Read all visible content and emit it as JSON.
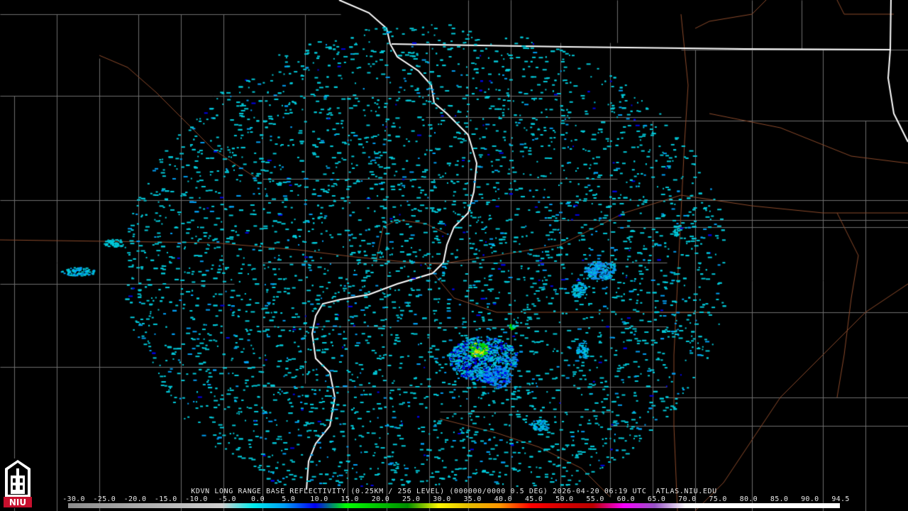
{
  "product": {
    "caption": "KDVN LONG RANGE BASE REFLECTIVITY (0.25KM / 256 LEVEL) (000000/0000 0.5 DEG) 2026-04-20 06:19 UTC  ATLAS.NIU.EDU"
  },
  "color_scale": {
    "labels": [
      "-30.0",
      "-25.0",
      "-20.0",
      "-15.0",
      "-10.0",
      "-5.0",
      "0.0",
      "5.0",
      "10.0",
      "15.0",
      "20.0",
      "25.0",
      "30.0",
      "35.0",
      "40.0",
      "45.0",
      "50.0",
      "55.0",
      "60.0",
      "65.0",
      "70.0",
      "75.0",
      "80.0",
      "85.0",
      "90.0",
      "94.5"
    ],
    "values": [
      -30,
      -25,
      -20,
      -15,
      -10,
      -5,
      0,
      5,
      10,
      15,
      20,
      25,
      30,
      35,
      40,
      45,
      50,
      55,
      60,
      65,
      70,
      75,
      80,
      85,
      90,
      94.5
    ],
    "colors": [
      "#8c8c8c",
      "#9a9a9a",
      "#a8a8a8",
      "#b5b5b5",
      "#c3c3c3",
      "#d0d0d0",
      "#02ecec",
      "#019ff4",
      "#0300f4",
      "#02fd02",
      "#01c501",
      "#008e00",
      "#fdf802",
      "#e5bc00",
      "#fd9500",
      "#fd0000",
      "#d40000",
      "#bc0000",
      "#f800fd",
      "#9854c6",
      "#fdfdfd",
      "#ffffff",
      "#ffffff",
      "#ffffff",
      "#ffffff",
      "#ffffff"
    ]
  },
  "logo": {
    "text": "NIU",
    "background": "#c8102e"
  },
  "map": {
    "background": "#000000",
    "county_line_color": "#6e6e6e",
    "state_line_color": "#ffffff",
    "highway_color": "#8b4a2b",
    "echo_colors": [
      "#02c9d9",
      "#019ff4",
      "#1a7cf0",
      "#0000e8",
      "#02dd02",
      "#e8e800"
    ]
  }
}
